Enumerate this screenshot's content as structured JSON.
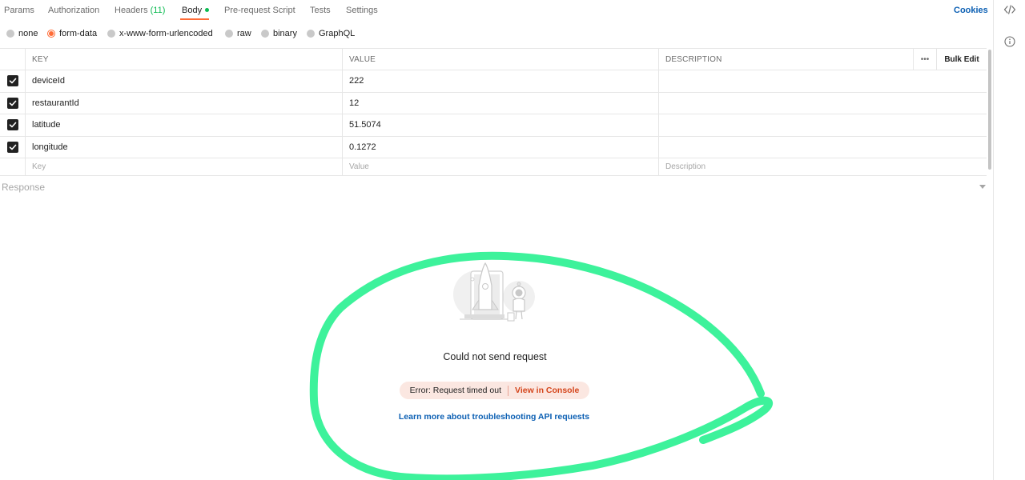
{
  "tabs": {
    "items": [
      {
        "label": "Params"
      },
      {
        "label": "Authorization"
      },
      {
        "label": "Headers",
        "count": "(11)"
      },
      {
        "label": "Body"
      },
      {
        "label": "Pre-request Script"
      },
      {
        "label": "Tests"
      },
      {
        "label": "Settings"
      }
    ],
    "active": "Body",
    "cookies_label": "Cookies"
  },
  "body_types": [
    {
      "label": "none",
      "selected": false
    },
    {
      "label": "form-data",
      "selected": true
    },
    {
      "label": "x-www-form-urlencoded",
      "selected": false
    },
    {
      "label": "raw",
      "selected": false
    },
    {
      "label": "binary",
      "selected": false
    },
    {
      "label": "GraphQL",
      "selected": false
    }
  ],
  "table": {
    "headers": {
      "key": "KEY",
      "value": "VALUE",
      "description": "DESCRIPTION",
      "more": "•••",
      "bulk_edit": "Bulk Edit"
    },
    "rows": [
      {
        "key": "deviceId",
        "value": "222",
        "description": "",
        "checked": true
      },
      {
        "key": "restaurantId",
        "value": "12",
        "description": "",
        "checked": true
      },
      {
        "key": "latitude",
        "value": "51.5074",
        "description": "",
        "checked": true
      },
      {
        "key": "longitude",
        "value": "0.1272",
        "description": "",
        "checked": true
      }
    ],
    "placeholders": {
      "key": "Key",
      "value": "Value",
      "description": "Description"
    }
  },
  "response": {
    "label": "Response",
    "title": "Could not send request",
    "error_text": "Error: Request timed out",
    "console_link": "View in Console",
    "learn_more": "Learn more about troubleshooting API requests"
  },
  "colors": {
    "accent": "#ff6c37",
    "link": "#0b5fb3",
    "success": "#0cbb52",
    "error": "#d4451b",
    "annotation": "#3df29b"
  },
  "icons": {
    "code": "code-icon",
    "info": "info-icon",
    "check": "check-icon",
    "caret": "chevron-down-icon"
  }
}
